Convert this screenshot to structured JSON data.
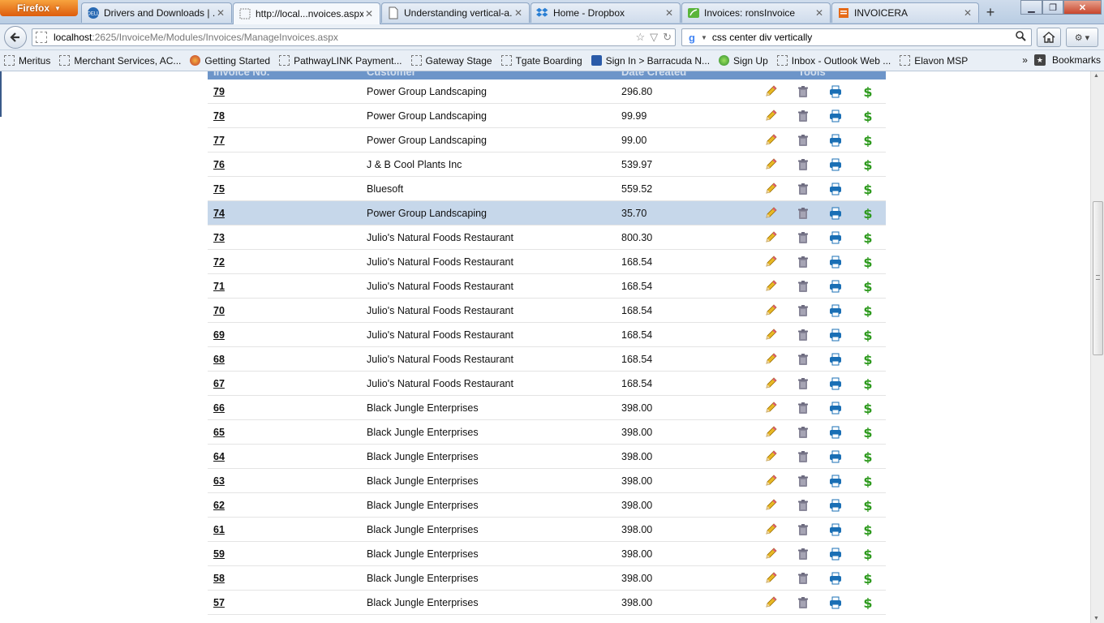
{
  "browser": {
    "menu_label": "Firefox",
    "tabs": [
      {
        "title": "Drivers and Downloads | ...",
        "icon": "dell-icon",
        "active": false
      },
      {
        "title": "http://local...nvoices.aspx",
        "icon": "blank-page-icon",
        "active": true
      },
      {
        "title": "Understanding vertical-a...",
        "icon": "page-icon",
        "active": false
      },
      {
        "title": "Home - Dropbox",
        "icon": "dropbox-icon",
        "active": false
      },
      {
        "title": "Invoices: ronsInvoice",
        "icon": "leaf-icon",
        "active": false
      },
      {
        "title": "INVOICERA",
        "icon": "invoicera-icon",
        "active": false
      }
    ],
    "url_host": "localhost",
    "url_path": ":2625/InvoiceMe/Modules/Invoices/ManageInvoices.aspx",
    "search_value": "css center div vertically",
    "search_engine_label": "g",
    "bookmarks": [
      {
        "label": "Meritus",
        "icon": "page-icon"
      },
      {
        "label": "Merchant Services, AC...",
        "icon": "page-icon"
      },
      {
        "label": "Getting Started",
        "icon": "firefox-icon"
      },
      {
        "label": "PathwayLINK Payment...",
        "icon": "page-icon"
      },
      {
        "label": "Gateway Stage",
        "icon": "page-icon"
      },
      {
        "label": "Tgate Boarding",
        "icon": "page-icon"
      },
      {
        "label": "Sign In > Barracuda N...",
        "icon": "barracuda-icon"
      },
      {
        "label": "Sign Up",
        "icon": "signup-icon"
      },
      {
        "label": "Inbox - Outlook Web ...",
        "icon": "page-icon"
      },
      {
        "label": "Elavon MSP",
        "icon": "page-icon"
      }
    ],
    "bookmarks_more": "»",
    "bookmarks_menu_label": "Bookmarks"
  },
  "table": {
    "header_labels": [
      "Invoice No.",
      "Customer",
      "Date Created",
      "Tools"
    ],
    "selected_index": 5,
    "rows": [
      {
        "invoice": "79",
        "customer": "Power Group Landscaping",
        "amount": "296.80"
      },
      {
        "invoice": "78",
        "customer": "Power Group Landscaping",
        "amount": "99.99"
      },
      {
        "invoice": "77",
        "customer": "Power Group Landscaping",
        "amount": "99.00"
      },
      {
        "invoice": "76",
        "customer": "J & B Cool Plants Inc",
        "amount": "539.97"
      },
      {
        "invoice": "75",
        "customer": "Bluesoft",
        "amount": "559.52"
      },
      {
        "invoice": "74",
        "customer": "Power Group Landscaping",
        "amount": "35.70"
      },
      {
        "invoice": "73",
        "customer": "Julio's Natural Foods Restaurant",
        "amount": "800.30"
      },
      {
        "invoice": "72",
        "customer": "Julio's Natural Foods Restaurant",
        "amount": "168.54"
      },
      {
        "invoice": "71",
        "customer": "Julio's Natural Foods Restaurant",
        "amount": "168.54"
      },
      {
        "invoice": "70",
        "customer": "Julio's Natural Foods Restaurant",
        "amount": "168.54"
      },
      {
        "invoice": "69",
        "customer": "Julio's Natural Foods Restaurant",
        "amount": "168.54"
      },
      {
        "invoice": "68",
        "customer": "Julio's Natural Foods Restaurant",
        "amount": "168.54"
      },
      {
        "invoice": "67",
        "customer": "Julio's Natural Foods Restaurant",
        "amount": "168.54"
      },
      {
        "invoice": "66",
        "customer": "Black Jungle Enterprises",
        "amount": "398.00"
      },
      {
        "invoice": "65",
        "customer": "Black Jungle Enterprises",
        "amount": "398.00"
      },
      {
        "invoice": "64",
        "customer": "Black Jungle Enterprises",
        "amount": "398.00"
      },
      {
        "invoice": "63",
        "customer": "Black Jungle Enterprises",
        "amount": "398.00"
      },
      {
        "invoice": "62",
        "customer": "Black Jungle Enterprises",
        "amount": "398.00"
      },
      {
        "invoice": "61",
        "customer": "Black Jungle Enterprises",
        "amount": "398.00"
      },
      {
        "invoice": "59",
        "customer": "Black Jungle Enterprises",
        "amount": "398.00"
      },
      {
        "invoice": "58",
        "customer": "Black Jungle Enterprises",
        "amount": "398.00"
      },
      {
        "invoice": "57",
        "customer": "Black Jungle Enterprises",
        "amount": "398.00"
      }
    ],
    "tool_icons": [
      "pencil-edit-icon",
      "trash-delete-icon",
      "printer-icon",
      "dollar-payment-icon"
    ]
  },
  "colors": {
    "header_bg": "#6d95c9",
    "selected_row": "#c6d7ea",
    "firefox_orange": "#e66a17",
    "printer_blue": "#1a6fb5",
    "dollar_green": "#2e9a1e",
    "trash_gray": "#7c7a8c",
    "pencil_yellow": "#e8b825"
  }
}
